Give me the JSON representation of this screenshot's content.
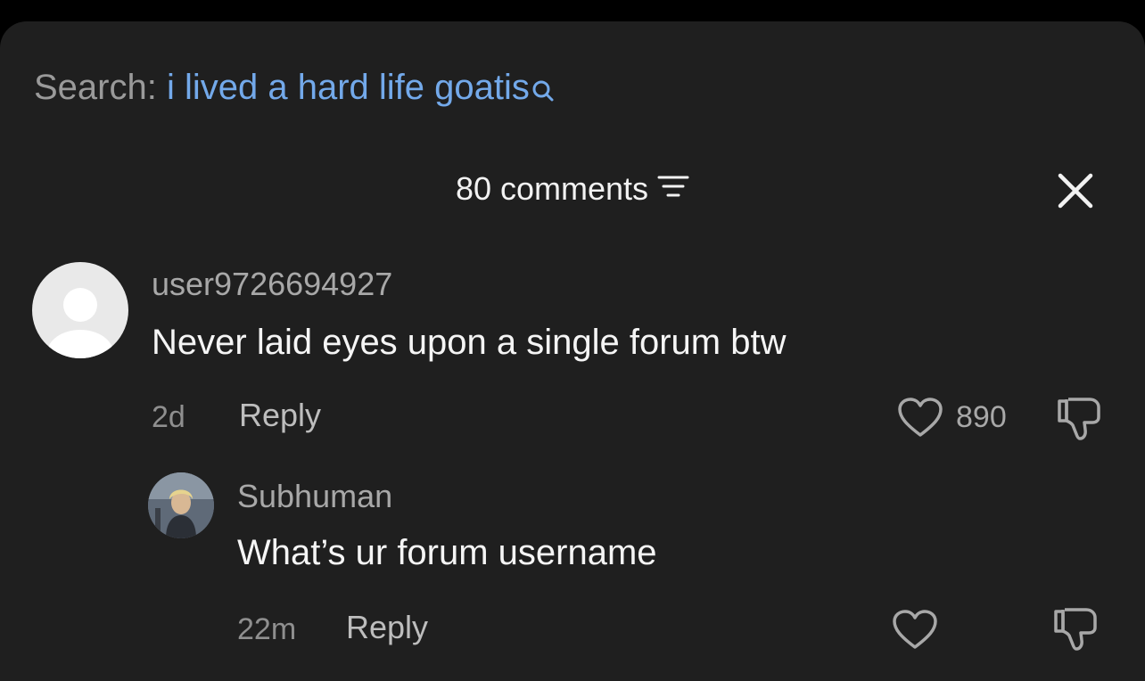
{
  "search": {
    "label": "Search:",
    "query": "i lived a hard life goatis"
  },
  "header": {
    "count_label": "80 comments"
  },
  "comments": [
    {
      "username": "user9726694927",
      "text": "Never laid eyes upon a single forum btw",
      "time": "2d",
      "reply_label": "Reply",
      "likes": "890"
    },
    {
      "username": "Subhuman",
      "text": "What’s ur forum username",
      "time": "22m",
      "reply_label": "Reply",
      "likes": ""
    }
  ],
  "colors": {
    "background": "#1f1f1f",
    "query": "#73a9ea",
    "text": "#f5f5f5",
    "muted": "#a8a8a8"
  },
  "icons": [
    "search-icon",
    "filter-icon",
    "close-icon",
    "heart-icon",
    "dislike-icon",
    "default-avatar",
    "user-avatar"
  ]
}
